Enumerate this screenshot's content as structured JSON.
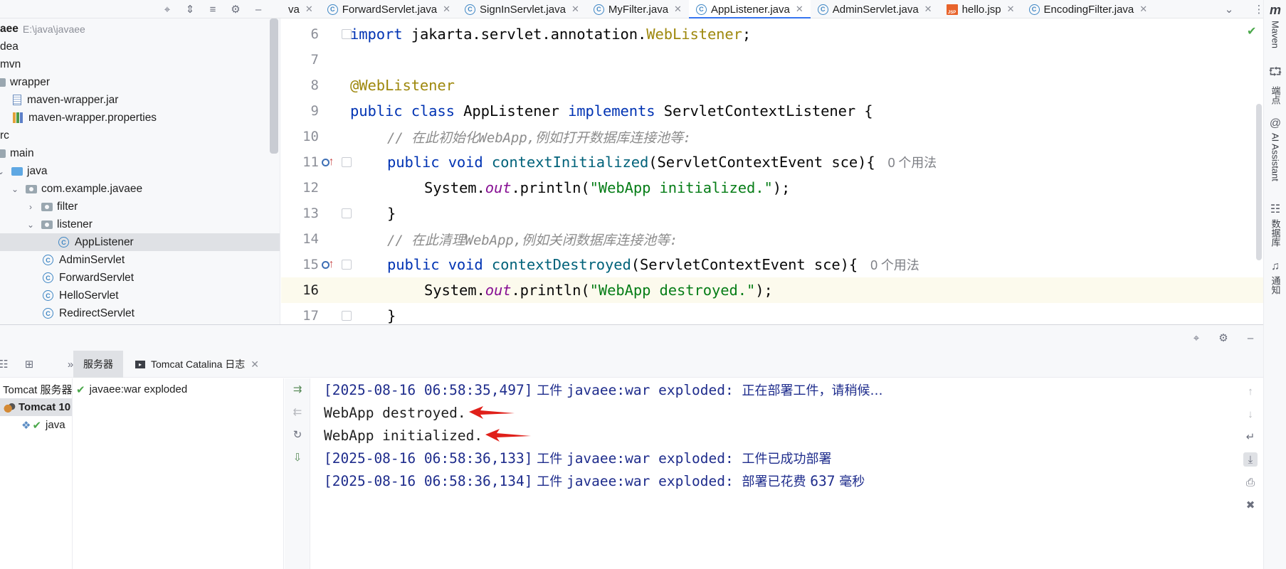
{
  "project_toolbar": {
    "icons": [
      "locate-icon",
      "expand-all-icon",
      "collapse-all-icon",
      "settings-icon",
      "minimize-icon"
    ]
  },
  "editor_tabs": [
    {
      "label": "va",
      "kind": "partial"
    },
    {
      "label": "ForwardServlet.java",
      "kind": "class"
    },
    {
      "label": "SignInServlet.java",
      "kind": "class"
    },
    {
      "label": "MyFilter.java",
      "kind": "class"
    },
    {
      "label": "AppListener.java",
      "kind": "class",
      "active": true
    },
    {
      "label": "AdminServlet.java",
      "kind": "class"
    },
    {
      "label": "hello.jsp",
      "kind": "jsp"
    },
    {
      "label": "EncodingFilter.java",
      "kind": "class"
    }
  ],
  "tree": {
    "root_name": "aee",
    "root_path": "E:\\java\\javaee",
    "items": [
      {
        "label": "dea"
      },
      {
        "label": "mvn"
      },
      {
        "label": "wrapper"
      },
      {
        "label": "maven-wrapper.jar"
      },
      {
        "label": "maven-wrapper.properties"
      },
      {
        "label": "rc"
      },
      {
        "label": "main"
      },
      {
        "label": "java"
      },
      {
        "label": "com.example.javaee"
      },
      {
        "label": "filter"
      },
      {
        "label": "listener"
      },
      {
        "label": "AppListener"
      },
      {
        "label": "AdminServlet"
      },
      {
        "label": "ForwardServlet"
      },
      {
        "label": "HelloServlet"
      },
      {
        "label": "RedirectServlet"
      }
    ]
  },
  "editor": {
    "line_numbers": [
      "6",
      "7",
      "8",
      "9",
      "10",
      "11",
      "12",
      "13",
      "14",
      "15",
      "16",
      "17"
    ],
    "current_line": "16",
    "code": {
      "l6_import": "import ",
      "l6_pkg": "jakarta.servlet.annotation.",
      "l6_ann": "WebListener",
      "l6_end": ";",
      "l8_ann": "@WebListener",
      "l9_public": "public ",
      "l9_class": "class ",
      "l9_name": "AppListener ",
      "l9_impl": "implements ",
      "l9_iface": "ServletContextListener {",
      "l10_comment": "// 在此初始化WebApp,例如打开数据库连接池等:",
      "l11_mods": "public void ",
      "l11_fn": "contextInitialized",
      "l11_params": "(ServletContextEvent sce){",
      "l11_hint": "0 个用法",
      "l12_sys": "System.",
      "l12_out": "out",
      "l12_call": ".println(",
      "l12_str": "\"WebApp initialized.\"",
      "l12_end": ");",
      "l13_brace": "}",
      "l14_comment": "// 在此清理WebApp,例如关闭数据库连接池等:",
      "l15_mods": "public void ",
      "l15_fn": "contextDestroyed",
      "l15_params": "(ServletContextEvent sce){",
      "l15_hint": "0 个用法",
      "l16_sys": "System.",
      "l16_out": "out",
      "l16_call": ".println(",
      "l16_str": "\"WebApp destroyed.\"",
      "l16_end": ");",
      "l17_brace": "}"
    }
  },
  "right_strip": {
    "maven": "Maven",
    "endpoints": "端点",
    "ai_assistant": "AI Assistant",
    "database": "数据库",
    "notifications": "通知"
  },
  "services": {
    "tabs": [
      {
        "label": "服务器",
        "active": true
      },
      {
        "label": "Tomcat Catalina 日志",
        "active": false
      }
    ],
    "tree": [
      {
        "label": "Tomcat 服务器"
      },
      {
        "label": "Tomcat 10"
      },
      {
        "label": "java"
      }
    ],
    "artifact": "javaee:war exploded",
    "console": [
      {
        "ts": "[2025-08-16 06:58:35,497]",
        "mid": " 工件 ",
        "art": "javaee:war exploded: ",
        "msg": "正在部署工件，请稍候…"
      },
      {
        "out": "WebApp destroyed."
      },
      {
        "out": "WebApp initialized."
      },
      {
        "ts": "[2025-08-16 06:58:36,133]",
        "mid": " 工件 ",
        "art": "javaee:war exploded: ",
        "msg": "工件已成功部署"
      },
      {
        "ts": "[2025-08-16 06:58:36,134]",
        "mid": " 工件 ",
        "art": "javaee:war exploded: ",
        "msg": "部署已花费 ",
        "num": "637",
        "unit": " 毫秒"
      }
    ]
  },
  "colors": {
    "accent": "#3574f0",
    "keyword": "#0033b3",
    "annotation": "#9e880d",
    "string": "#067d17",
    "method": "#00627a",
    "log_text": "#1e2c8c",
    "arrow": "#e0201a"
  }
}
